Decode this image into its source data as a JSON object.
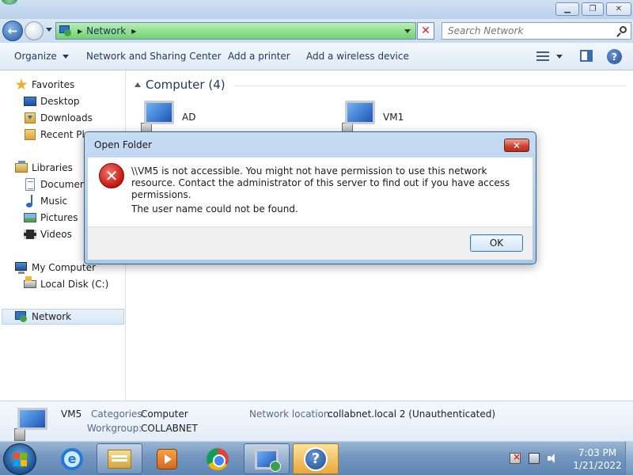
{
  "explorer": {
    "address": {
      "location": "Network"
    },
    "search": {
      "placeholder": "Search Network"
    },
    "toolbar": {
      "organize": "Organize",
      "network_sharing": "Network and Sharing Center",
      "add_printer": "Add a printer",
      "add_wireless": "Add a wireless device"
    },
    "sidebar": {
      "favorites": "Favorites",
      "desktop": "Desktop",
      "downloads": "Downloads",
      "recent_places": "Recent Places",
      "libraries": "Libraries",
      "documents": "Documents",
      "music": "Music",
      "pictures": "Pictures",
      "videos": "Videos",
      "my_computer": "My Computer",
      "local_disk": "Local Disk (C:)",
      "network": "Network"
    },
    "content": {
      "group_title": "Computer (4)",
      "items": [
        "AD",
        "VM1"
      ]
    },
    "details": {
      "name": "VM5",
      "categories_label": "Categories:",
      "categories_value": "Computer",
      "workgroup_label": "Workgroup:",
      "workgroup_value": "COLLABNET",
      "network_location_label": "Network location:",
      "network_location_value": "collabnet.local  2 (Unauthenticated)"
    }
  },
  "dialog": {
    "title": "Open Folder",
    "close_symbol": "✕",
    "message": "\\\\VM5 is not accessible. You might not have permission to use this network resource. Contact the administrator of this server to find out if you have access permissions.",
    "detail": "The user name could not be found.",
    "ok_label": "OK"
  },
  "taskbar": {
    "clock_time": "7:03 PM",
    "clock_date": "1/21/2022",
    "help_symbol": "?",
    "ie_symbol": "e"
  },
  "colors": {
    "address_bar_green": "#6fd271",
    "dialog_frame": "#a9c7e8",
    "error_red": "#c2170f",
    "taskbar_blue": "#7396bf",
    "active_task_orange": "#eaa73a"
  },
  "icons": {
    "window": [
      "minimize-icon",
      "maximize-icon",
      "close-icon"
    ],
    "navigation": [
      "back-arrow-icon",
      "forward-arrow-icon",
      "network-icon",
      "search-icon"
    ],
    "toolbar": [
      "views-icon",
      "preview-pane-icon",
      "help-icon"
    ],
    "sidebar": [
      "star-icon",
      "desktop-icon",
      "downloads-icon",
      "recent-places-icon",
      "libraries-icon",
      "documents-icon",
      "music-icon",
      "pictures-icon",
      "videos-icon",
      "computer-icon",
      "local-disk-icon",
      "network-icon"
    ],
    "dialog": [
      "error-icon"
    ],
    "taskbar": [
      "windows-start-icon",
      "internet-explorer-icon",
      "windows-explorer-icon",
      "media-player-icon",
      "chrome-icon",
      "remote-desktop-icon",
      "help-and-support-icon",
      "action-center-flag-icon",
      "network-tray-icon",
      "volume-icon"
    ]
  }
}
